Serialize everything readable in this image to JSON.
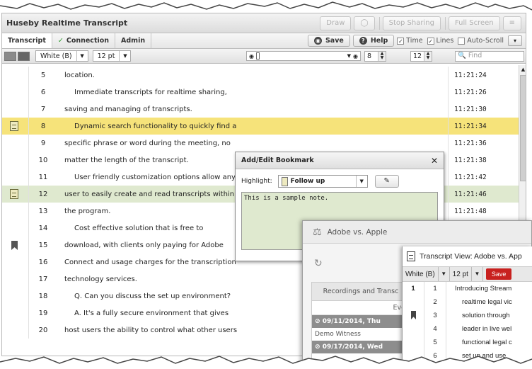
{
  "app": {
    "title": "Huseby Realtime Transcript",
    "title_buttons": [
      "Draw",
      "Stop Sharing",
      "Full Screen"
    ],
    "tabs": [
      {
        "label": "Transcript"
      },
      {
        "label": "Connection",
        "check": "✓"
      },
      {
        "label": "Admin"
      }
    ],
    "actions": {
      "save": "Save",
      "help": "Help"
    },
    "options": {
      "time": "Time",
      "lines": "Lines",
      "autoscroll": "Auto-Scroll"
    },
    "format": {
      "color": "White (B)",
      "size": "12 pt"
    },
    "spin_a": "8",
    "spin_b": "12",
    "find_placeholder": "Find"
  },
  "transcript": {
    "rows": [
      {
        "line": "5",
        "text": "location.",
        "time": "11:21:24",
        "style": "",
        "icon": "",
        "indent": false
      },
      {
        "line": "6",
        "text": "Immediate transcripts for realtime sharing,",
        "time": "11:21:26",
        "style": "",
        "icon": "",
        "indent": true
      },
      {
        "line": "7",
        "text": "saving and managing of transcripts.",
        "time": "11:21:30",
        "style": "",
        "icon": "",
        "indent": false
      },
      {
        "line": "8",
        "text": "Dynamic search functionality to quickly find a",
        "time": "11:21:34",
        "style": "yellow",
        "icon": "note",
        "indent": true
      },
      {
        "line": "9",
        "text": "specific phrase or word during the meeting, no",
        "time": "11:21:36",
        "style": "",
        "icon": "",
        "indent": false
      },
      {
        "line": "10",
        "text": "matter the length of the transcript.",
        "time": "11:21:38",
        "style": "",
        "icon": "",
        "indent": false
      },
      {
        "line": "11",
        "text": "User friendly customization options allow any",
        "time": "11:21:42",
        "style": "",
        "icon": "",
        "indent": true
      },
      {
        "line": "12",
        "text": "user to easily create and read transcripts within",
        "time": "11:21:46",
        "style": "green",
        "icon": "note",
        "indent": false
      },
      {
        "line": "13",
        "text": "the program.",
        "time": "11:21:48",
        "style": "",
        "icon": "",
        "indent": false
      },
      {
        "line": "14",
        "text": "Cost effective solution that is free to",
        "time": "",
        "style": "",
        "icon": "",
        "indent": true
      },
      {
        "line": "15",
        "text": "download, with clients only paying for Adobe",
        "time": "",
        "style": "",
        "icon": "bookmark",
        "indent": false
      },
      {
        "line": "16",
        "text": "Connect and usage charges for the transcription",
        "time": "",
        "style": "",
        "icon": "",
        "indent": false
      },
      {
        "line": "17",
        "text": "technology services.",
        "time": "",
        "style": "",
        "icon": "",
        "indent": false
      },
      {
        "line": "18",
        "text": "Q.  Can you discuss the set up environment?",
        "time": "",
        "style": "",
        "icon": "",
        "indent": true
      },
      {
        "line": "19",
        "text": "A.  It's a fully secure environment that gives",
        "time": "",
        "style": "",
        "icon": "",
        "indent": true
      },
      {
        "line": "20",
        "text": "host users the ability to control what other users",
        "time": "",
        "style": "",
        "icon": "",
        "indent": false
      }
    ]
  },
  "bookmark_dialog": {
    "title": "Add/Edit Bookmark",
    "close": "✕",
    "highlight_label": "Highlight:",
    "highlight_value": "Follow up",
    "note": "This is a sample note."
  },
  "case_window": {
    "title": "Adobe vs. Apple",
    "pane_title": "Recordings and Transc",
    "pane_sub": "Eve",
    "dates": [
      {
        "date": "09/11/2014, Thu",
        "item": "Demo Witness"
      },
      {
        "date": "09/17/2014, Wed",
        "item": ""
      }
    ]
  },
  "transcript_view": {
    "title": "Transcript View: Adobe vs. App",
    "color": "White (B)",
    "size": "12 pt",
    "save": "Save",
    "rows": [
      {
        "page": "1",
        "line": "1",
        "text": "Introducing Stream",
        "indent": false,
        "bookmark": false
      },
      {
        "page": "",
        "line": "2",
        "text": "realtime legal vic",
        "indent": true,
        "bookmark": false
      },
      {
        "page": "",
        "line": "3",
        "text": "solution through",
        "indent": true,
        "bookmark": true
      },
      {
        "page": "",
        "line": "4",
        "text": "leader in live wel",
        "indent": true,
        "bookmark": false
      },
      {
        "page": "",
        "line": "5",
        "text": "functional legal c",
        "indent": true,
        "bookmark": false
      },
      {
        "page": "",
        "line": "6",
        "text": "set up and use",
        "indent": true,
        "bookmark": false
      }
    ]
  }
}
